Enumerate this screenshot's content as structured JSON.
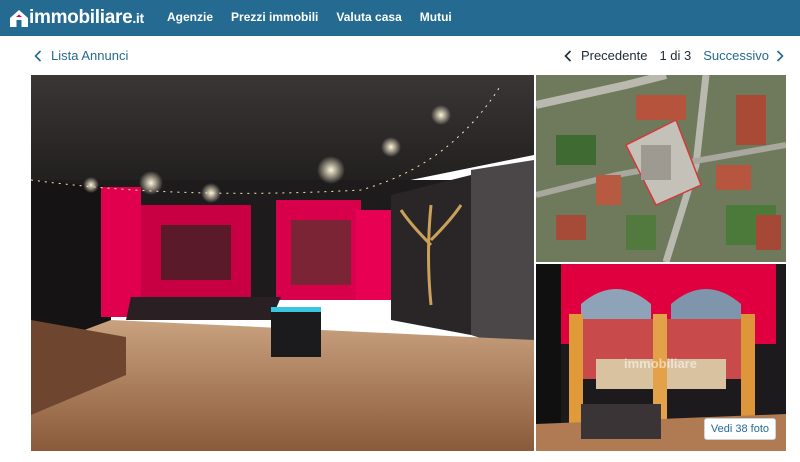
{
  "header": {
    "logo_main": "immobiliare",
    "logo_tld": ".it",
    "nav": [
      "Agenzie",
      "Prezzi immobili",
      "Valuta casa",
      "Mutui"
    ]
  },
  "subnav": {
    "back_label": "Lista Annunci",
    "prev_label": "Precedente",
    "counter": "1 di 3",
    "next_label": "Successivo"
  },
  "gallery": {
    "see_all_label": "Vedi 38 foto",
    "watermark": "immobiliare"
  },
  "colors": {
    "brand_blue": "#256a90",
    "accent_red": "#e0004d"
  },
  "icons": {
    "logo": "house-icon",
    "back": "chevron-left-icon",
    "prev": "chevron-left-icon",
    "next": "chevron-right-icon"
  }
}
